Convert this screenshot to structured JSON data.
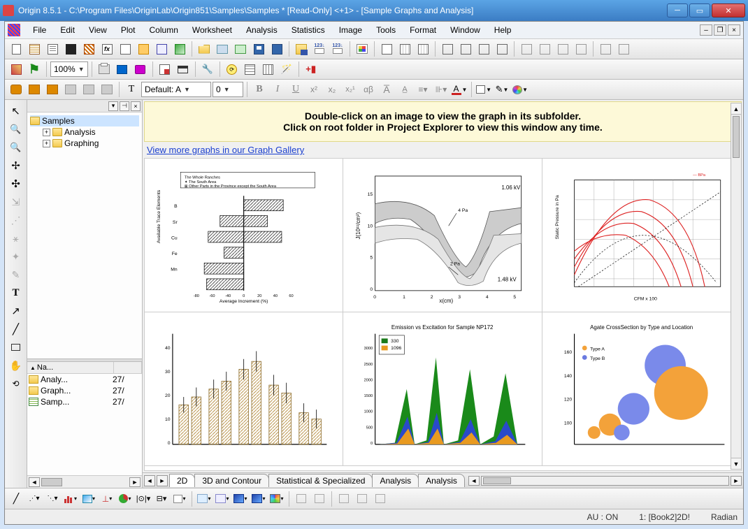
{
  "title": "Origin 8.5.1 - C:\\Program Files\\OriginLab\\Origin851\\Samples\\Samples * [Read-Only] <+1> - [Sample Graphs and Analysis]",
  "menu": [
    "File",
    "Edit",
    "View",
    "Plot",
    "Column",
    "Worksheet",
    "Analysis",
    "Statistics",
    "Image",
    "Tools",
    "Format",
    "Window",
    "Help"
  ],
  "zoom": "100%",
  "font_name": "Default: A",
  "font_size": "0",
  "tree": {
    "root": "Samples",
    "children": [
      "Analysis",
      "Graphing"
    ]
  },
  "pe_columns": [
    "Na...",
    ""
  ],
  "pe_rows": [
    {
      "name": "Analy...",
      "date": "27/",
      "type": "folder"
    },
    {
      "name": "Graph...",
      "date": "27/",
      "type": "folder"
    },
    {
      "name": "Samp...",
      "date": "27/",
      "type": "wks"
    }
  ],
  "banner": {
    "l1": "Double-click on an image to view the graph in its subfolder.",
    "l2": "Click on root folder in Project Explorer to view this window any time."
  },
  "link_text": "View more graphs in our Graph Gallery",
  "tabs": [
    "2D",
    "3D and Contour",
    "Statistical & Specialized",
    "Analysis",
    "Analysis"
  ],
  "active_tab": 0,
  "statusbar": {
    "a": "AU : ON",
    "b": "1: [Book2]2D!",
    "c": "Radian"
  }
}
